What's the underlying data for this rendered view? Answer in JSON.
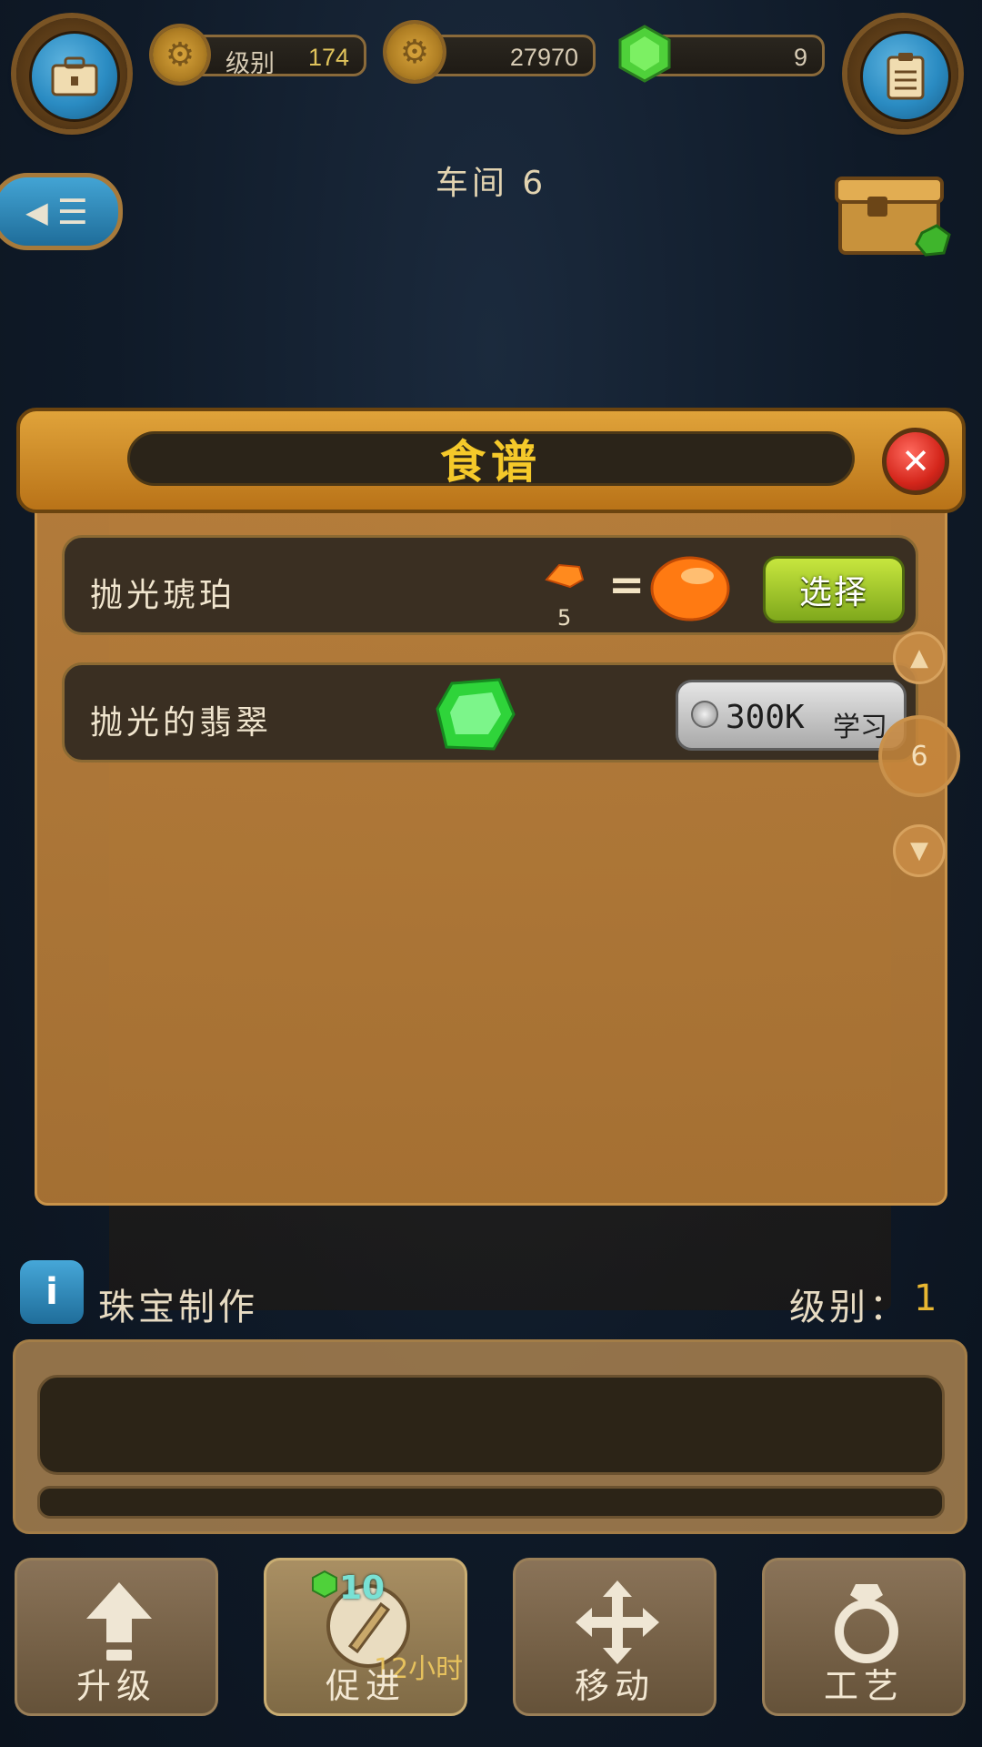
{
  "topbar": {
    "level_label": "级别",
    "level_value": "174",
    "coins": "27970",
    "gems": "9"
  },
  "header": {
    "title": "车间 6"
  },
  "recipe_panel": {
    "title": "食谱",
    "recipes": [
      {
        "name": "抛光琥珀",
        "input_count": "5",
        "action_label": "选择"
      },
      {
        "name": "抛光的翡翠",
        "cost": "300K",
        "action_label": "学习"
      }
    ],
    "page_number": "6"
  },
  "workshop": {
    "name": "珠宝制作",
    "level_label": "级别：",
    "level_value": "1"
  },
  "actions": [
    {
      "label": "升级",
      "icon": "upgrade-arrow-icon"
    },
    {
      "label": "促进",
      "icon": "compass-icon",
      "gem_cost": "10",
      "time": "12小时"
    },
    {
      "label": "移动",
      "icon": "move-arrows-icon"
    },
    {
      "label": "工艺",
      "icon": "ring-icon"
    }
  ],
  "colors": {
    "accent_gold": "#f5c92a",
    "panel_orange": "#c4843d",
    "select_green": "#a3c92c",
    "info_blue": "#2a8bc2"
  }
}
